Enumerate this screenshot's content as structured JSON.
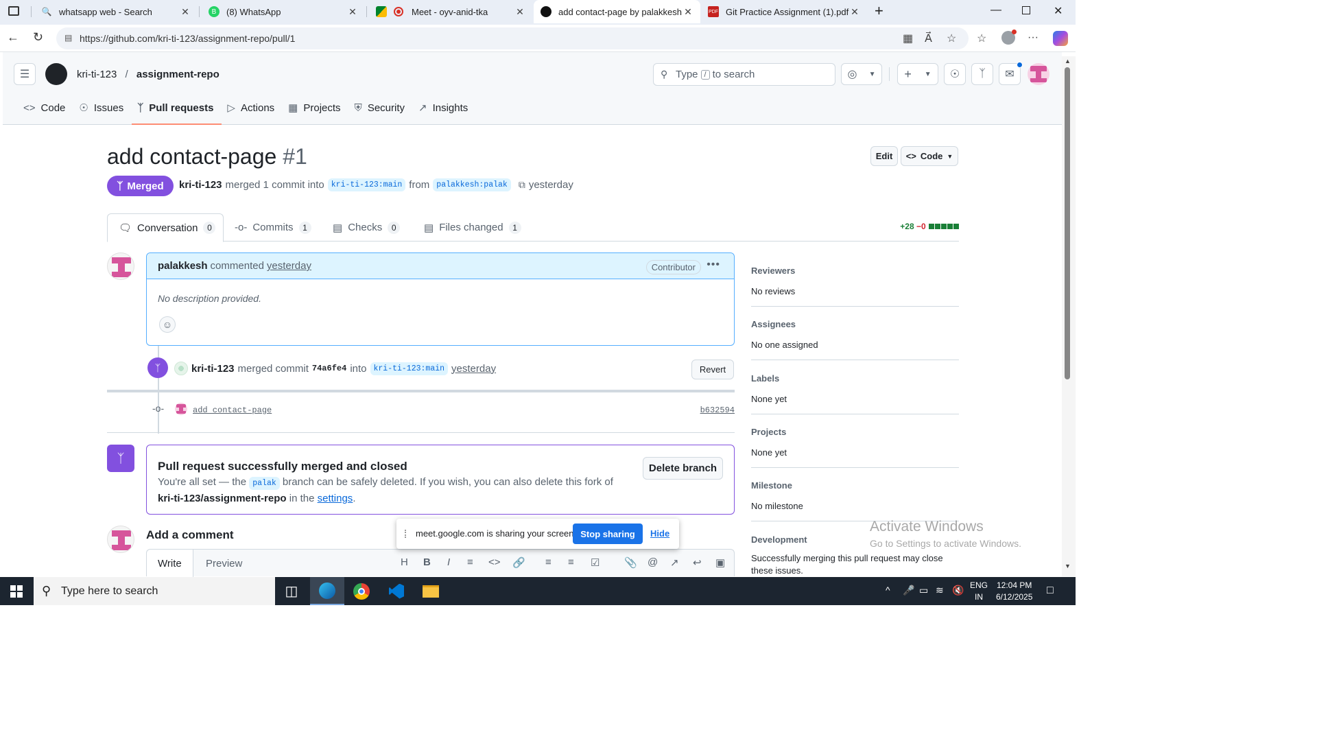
{
  "browser": {
    "tabs": [
      {
        "label": "whatsapp web - Search",
        "icon": "search-icon"
      },
      {
        "label": "(8) WhatsApp",
        "icon": "whatsapp-icon"
      },
      {
        "label": "Meet - oyv-anid-tka",
        "icon": "meet-icon"
      },
      {
        "label": "add contact-page by palakkesh · P",
        "icon": "github-icon"
      },
      {
        "label": "Git Practice Assignment (1).pdf",
        "icon": "pdf-icon"
      }
    ],
    "url": "https://github.com/kri-ti-123/assignment-repo/pull/1"
  },
  "repo": {
    "owner": "kri-ti-123",
    "separator": "/",
    "name": "assignment-repo",
    "search_placeholder_pre": "Type",
    "search_key": "/",
    "search_placeholder_post": "to search",
    "tabs": [
      {
        "label": "Code",
        "icon": "code-icon"
      },
      {
        "label": "Issues",
        "icon": "issue-icon"
      },
      {
        "label": "Pull requests",
        "icon": "pull-request-icon"
      },
      {
        "label": "Actions",
        "icon": "play-icon"
      },
      {
        "label": "Projects",
        "icon": "table-icon"
      },
      {
        "label": "Security",
        "icon": "shield-icon"
      },
      {
        "label": "Insights",
        "icon": "graph-icon"
      }
    ]
  },
  "pr": {
    "title": "add contact-page",
    "number": "#1",
    "edit_label": "Edit",
    "code_label": "Code",
    "state": "Merged",
    "author": "kri-ti-123",
    "merged_text": "merged 1 commit into",
    "base_branch": "kri-ti-123:main",
    "from_text": "from",
    "head_branch": "palakkesh:palak",
    "time": "yesterday",
    "tabs": [
      {
        "label": "Conversation",
        "count": "0"
      },
      {
        "label": "Commits",
        "count": "1"
      },
      {
        "label": "Checks",
        "count": "0"
      },
      {
        "label": "Files changed",
        "count": "1"
      }
    ],
    "additions": "+28",
    "deletions": "−0"
  },
  "comment": {
    "author": "palakkesh",
    "action": "commented",
    "time": "yesterday",
    "role": "Contributor",
    "body": "No description provided."
  },
  "merge_event": {
    "author": "kri-ti-123",
    "action": "merged commit",
    "sha": "74a6fe4",
    "into": "into",
    "branch": "kri-ti-123:main",
    "time": "yesterday",
    "revert_label": "Revert"
  },
  "commit": {
    "message": "add contact-page",
    "sha": "b632594"
  },
  "merged_box": {
    "title": "Pull request successfully merged and closed",
    "desc_pre": "You're all set — the",
    "branch": "palak",
    "desc_mid": "branch can be safely deleted. If you wish, you can also delete this fork of",
    "fork": "kri-ti-123/assignment-repo",
    "desc_in": "in the",
    "settings": "settings",
    "desc_end": ".",
    "delete_label": "Delete branch"
  },
  "add_comment": {
    "title": "Add a comment",
    "write": "Write",
    "preview": "Preview"
  },
  "sidebar": [
    {
      "title": "Reviewers",
      "value": "No reviews"
    },
    {
      "title": "Assignees",
      "value": "No one assigned"
    },
    {
      "title": "Labels",
      "value": "None yet"
    },
    {
      "title": "Projects",
      "value": "None yet"
    },
    {
      "title": "Milestone",
      "value": "No milestone"
    },
    {
      "title": "Development",
      "value": "Successfully merging this pull request may close these issues."
    }
  ],
  "share": {
    "text": "meet.google.com is sharing your screen.",
    "stop": "Stop sharing",
    "hide": "Hide"
  },
  "watermark": {
    "line1": "Activate Windows",
    "line2": "Go to Settings to activate Windows."
  },
  "taskbar": {
    "search_placeholder": "Type here to search",
    "lang1": "ENG",
    "lang2": "IN",
    "time": "12:04 PM",
    "date": "6/12/2025"
  },
  "colors": {
    "merged": "#8250df",
    "link": "#0969da",
    "additions": "#1a7f37",
    "deletions": "#d1242f"
  }
}
